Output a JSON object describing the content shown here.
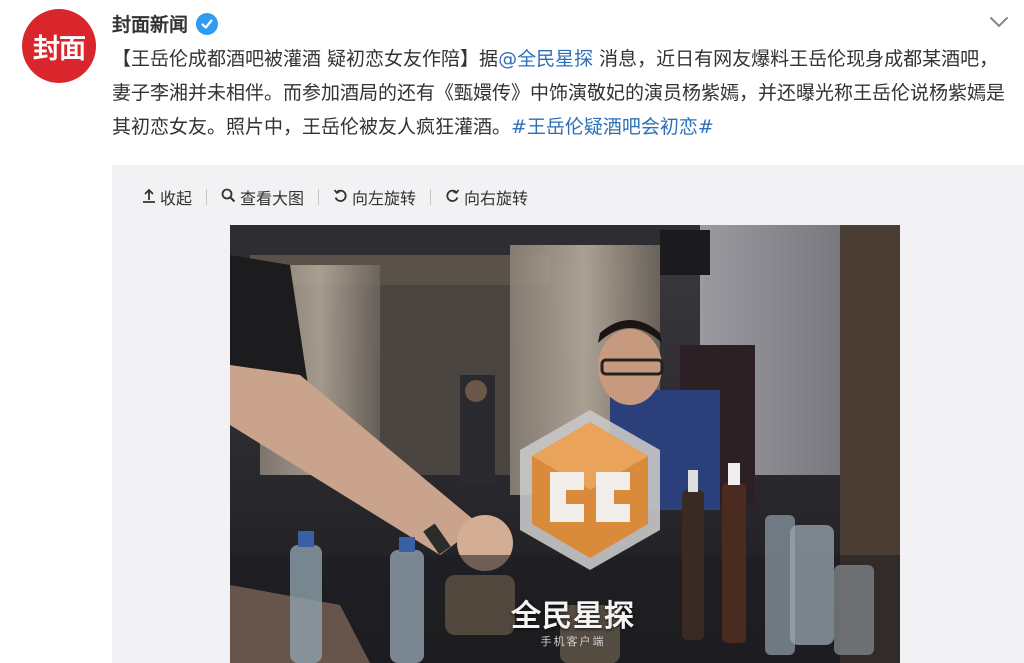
{
  "post": {
    "avatar_text": "封面",
    "author": "封面新闻",
    "verified_icon": "verified-badge-icon",
    "menu_icon": "chevron-down-icon",
    "text": {
      "title": "【王岳伦成都酒吧被灌酒 疑初恋女友作陪】",
      "part1": "据",
      "mention": "@全民星探",
      "part2": " 消息，近日有网友爆料王岳伦现身成都某酒吧，妻子李湘并未相伴。而参加酒局的还有《甄嬛传》中饰演敬妃的演员杨紫嫣，并还曝光称王岳伦说杨紫嫣是其初恋女友。照片中，王岳伦被友人疯狂灌酒。",
      "hashtag": "#王岳伦疑酒吧会初恋#"
    },
    "colors": {
      "avatar": "#d9262c",
      "link": "#2e6fb7",
      "verified": "#2f9cf0",
      "watermark": "#d98a3a"
    }
  },
  "media": {
    "toolbar": [
      {
        "icon": "collapse-arrow-icon",
        "label": "收起"
      },
      {
        "icon": "magnifier-icon",
        "label": "查看大图"
      },
      {
        "icon": "rotate-left-icon",
        "label": "向左旋转"
      },
      {
        "icon": "rotate-right-icon",
        "label": "向右旋转"
      }
    ],
    "watermark": {
      "text": "全民星探",
      "sub": "手机客户端"
    }
  }
}
